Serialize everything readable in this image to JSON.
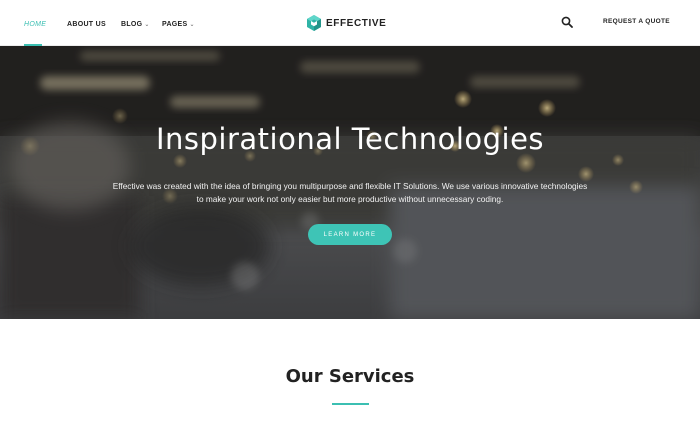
{
  "header": {
    "nav": [
      {
        "label": "HOME",
        "active": true
      },
      {
        "label": "ABOUT US"
      },
      {
        "label": "BLOG",
        "has_dropdown": true
      },
      {
        "label": "PAGES",
        "has_dropdown": true
      }
    ],
    "caret_glyph": "⌄",
    "logo_text": "EFFECTIVE",
    "search_icon": "search-icon",
    "quote_label": "REQUEST A QUOTE"
  },
  "hero": {
    "title": "Inspirational Technologies",
    "text_line1": "Effective was created with the idea of bringing you multipurpose and flexible IT Solutions. We use various innovative technologies",
    "text_line2": "to make your work not only easier but more productive without unnecessary coding.",
    "button_label": "LEARN MORE"
  },
  "services": {
    "title": "Our Services"
  },
  "colors": {
    "accent": "#3bbfb2",
    "button": "#3ec4b6",
    "text_dark": "#222222"
  }
}
